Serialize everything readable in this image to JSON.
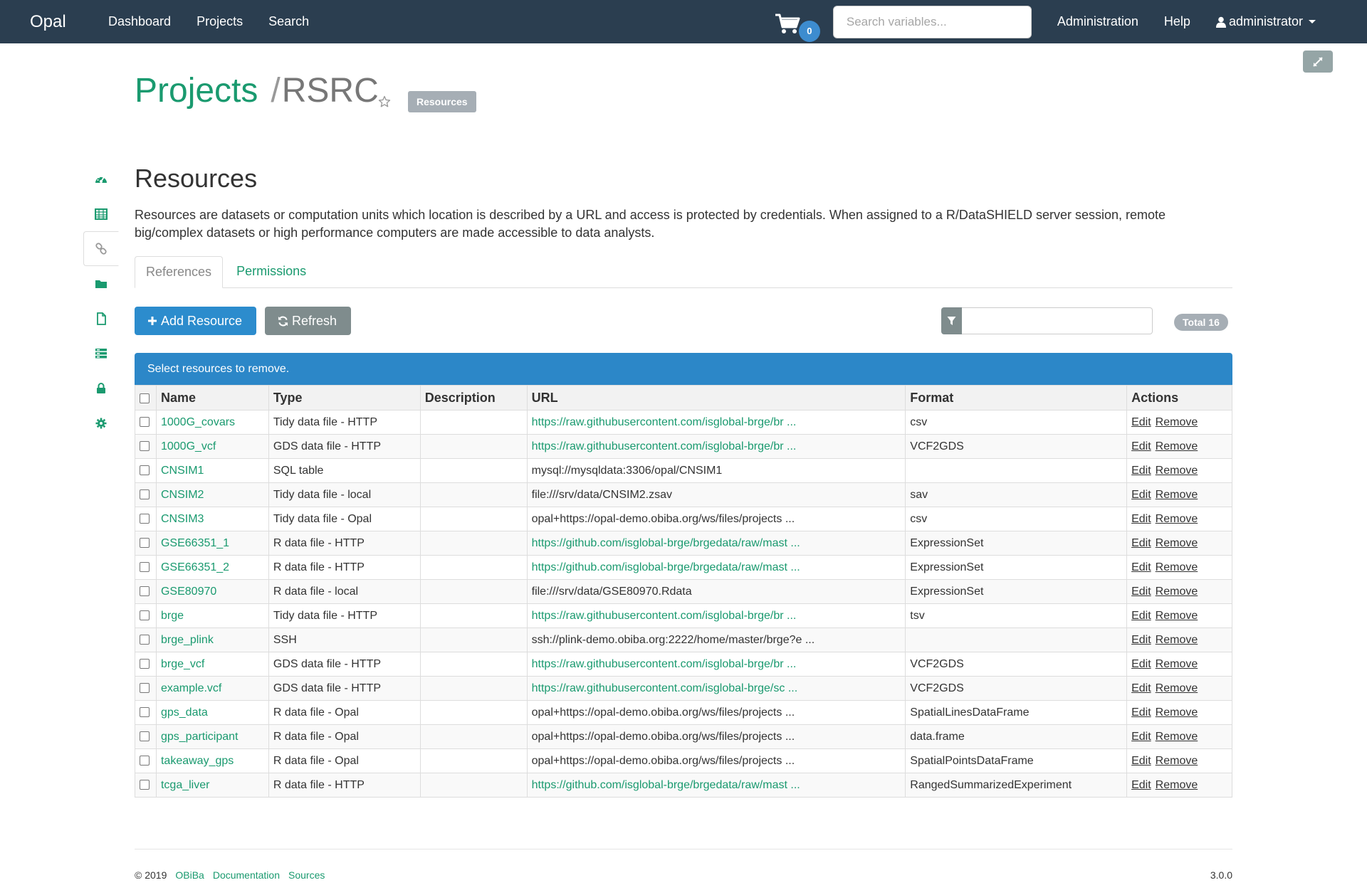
{
  "navbar": {
    "brand": "Opal",
    "links": [
      "Dashboard",
      "Projects",
      "Search"
    ],
    "cart_count": "0",
    "search_placeholder": "Search variables...",
    "admin": "Administration",
    "help": "Help",
    "user": "administrator"
  },
  "header": {
    "crumb_root": "Projects",
    "crumb_sep": "/",
    "crumb_current": "RSRC",
    "badge": "Resources"
  },
  "sidebar": {
    "icons": [
      "dashboard-icon",
      "table-icon",
      "link-icon",
      "folder-icon",
      "file-icon",
      "list-icon",
      "lock-icon",
      "cog-icon"
    ],
    "active_index": 2
  },
  "main": {
    "title": "Resources",
    "description": "Resources are datasets or computation units which location is described by a URL and access is protected by credentials. When assigned to a R/DataSHIELD server session, remote big/complex datasets or high performance computers are made accessible to data analysts.",
    "tabs": [
      {
        "label": "References",
        "active": true
      },
      {
        "label": "Permissions",
        "active": false
      }
    ],
    "add_button": "Add Resource",
    "refresh_button": "Refresh",
    "total_badge": "Total 16",
    "alert_text": "Select resources to remove."
  },
  "table": {
    "columns": [
      "Name",
      "Type",
      "Description",
      "URL",
      "Format",
      "Actions"
    ],
    "edit_label": "Edit",
    "remove_label": "Remove",
    "rows": [
      {
        "name": "1000G_covars",
        "type": "Tidy data file - HTTP",
        "description": "",
        "url": "https://raw.githubusercontent.com/isglobal-brge/br ...",
        "url_link": true,
        "format": "csv"
      },
      {
        "name": "1000G_vcf",
        "type": "GDS data file - HTTP",
        "description": "",
        "url": "https://raw.githubusercontent.com/isglobal-brge/br ...",
        "url_link": true,
        "format": "VCF2GDS"
      },
      {
        "name": "CNSIM1",
        "type": "SQL table",
        "description": "",
        "url": "mysql://mysqldata:3306/opal/CNSIM1",
        "url_link": false,
        "format": ""
      },
      {
        "name": "CNSIM2",
        "type": "Tidy data file - local",
        "description": "",
        "url": "file:///srv/data/CNSIM2.zsav",
        "url_link": false,
        "format": "sav"
      },
      {
        "name": "CNSIM3",
        "type": "Tidy data file - Opal",
        "description": "",
        "url": "opal+https://opal-demo.obiba.org/ws/files/projects ...",
        "url_link": false,
        "format": "csv"
      },
      {
        "name": "GSE66351_1",
        "type": "R data file - HTTP",
        "description": "",
        "url": "https://github.com/isglobal-brge/brgedata/raw/mast ...",
        "url_link": true,
        "format": "ExpressionSet"
      },
      {
        "name": "GSE66351_2",
        "type": "R data file - HTTP",
        "description": "",
        "url": "https://github.com/isglobal-brge/brgedata/raw/mast ...",
        "url_link": true,
        "format": "ExpressionSet"
      },
      {
        "name": "GSE80970",
        "type": "R data file - local",
        "description": "",
        "url": "file:///srv/data/GSE80970.Rdata",
        "url_link": false,
        "format": "ExpressionSet"
      },
      {
        "name": "brge",
        "type": "Tidy data file - HTTP",
        "description": "",
        "url": "https://raw.githubusercontent.com/isglobal-brge/br ...",
        "url_link": true,
        "format": "tsv"
      },
      {
        "name": "brge_plink",
        "type": "SSH",
        "description": "",
        "url": "ssh://plink-demo.obiba.org:2222/home/master/brge?e ...",
        "url_link": false,
        "format": ""
      },
      {
        "name": "brge_vcf",
        "type": "GDS data file - HTTP",
        "description": "",
        "url": "https://raw.githubusercontent.com/isglobal-brge/br ...",
        "url_link": true,
        "format": "VCF2GDS"
      },
      {
        "name": "example.vcf",
        "type": "GDS data file - HTTP",
        "description": "",
        "url": "https://raw.githubusercontent.com/isglobal-brge/sc ...",
        "url_link": true,
        "format": "VCF2GDS"
      },
      {
        "name": "gps_data",
        "type": "R data file - Opal",
        "description": "",
        "url": "opal+https://opal-demo.obiba.org/ws/files/projects ...",
        "url_link": false,
        "format": "SpatialLinesDataFrame"
      },
      {
        "name": "gps_participant",
        "type": "R data file - Opal",
        "description": "",
        "url": "opal+https://opal-demo.obiba.org/ws/files/projects ...",
        "url_link": false,
        "format": "data.frame"
      },
      {
        "name": "takeaway_gps",
        "type": "R data file - Opal",
        "description": "",
        "url": "opal+https://opal-demo.obiba.org/ws/files/projects ...",
        "url_link": false,
        "format": "SpatialPointsDataFrame"
      },
      {
        "name": "tcga_liver",
        "type": "R data file - HTTP",
        "description": "",
        "url": "https://github.com/isglobal-brge/brgedata/raw/mast ...",
        "url_link": true,
        "format": "RangedSummarizedExperiment"
      }
    ]
  },
  "footer": {
    "copyright": "© 2019",
    "obiba": "OBiBa",
    "documentation": "Documentation",
    "sources": "Sources",
    "version": "3.0.0"
  },
  "colors": {
    "navbar": "#2b3e50",
    "accent_green": "#1a9a6f",
    "primary_blue": "#2c8ccd",
    "muted_gray": "#7f8c8d"
  }
}
